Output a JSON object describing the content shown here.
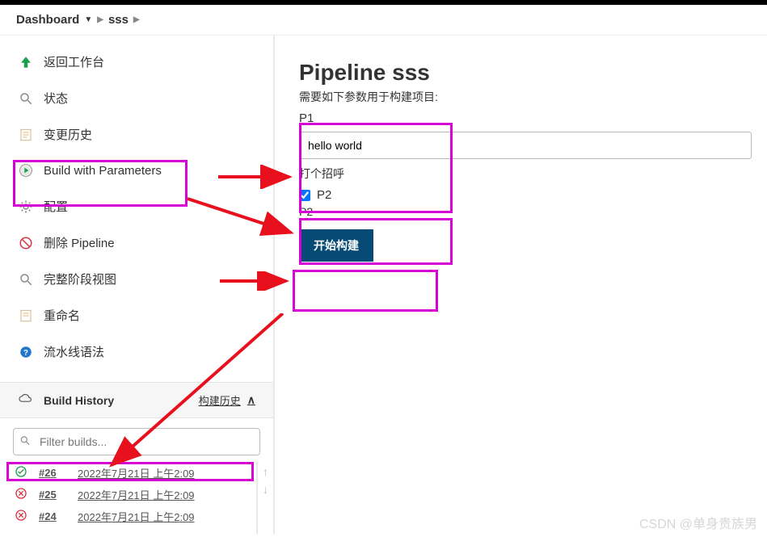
{
  "breadcrumbs": {
    "dashboard": "Dashboard",
    "project": "sss"
  },
  "sidebar": {
    "items": [
      {
        "label": "返回工作台",
        "icon": "arrow-up"
      },
      {
        "label": "状态",
        "icon": "search"
      },
      {
        "label": "变更历史",
        "icon": "notes"
      },
      {
        "label": "Build with Parameters",
        "icon": "play-gear"
      },
      {
        "label": "配置",
        "icon": "gear"
      },
      {
        "label": "删除 Pipeline",
        "icon": "delete"
      },
      {
        "label": "完整阶段视图",
        "icon": "search"
      },
      {
        "label": "重命名",
        "icon": "notes"
      },
      {
        "label": "流水线语法",
        "icon": "help"
      }
    ]
  },
  "buildHistory": {
    "title": "Build History",
    "subtitle": "构建历史",
    "filterPlaceholder": "Filter builds...",
    "rows": [
      {
        "num": "#26",
        "time": "2022年7月21日 上午2:09",
        "status": "ok"
      },
      {
        "num": "#25",
        "time": "2022年7月21日 上午2:09",
        "status": "fail"
      },
      {
        "num": "#24",
        "time": "2022年7月21日 上午2:09",
        "status": "fail"
      }
    ]
  },
  "page": {
    "title": "Pipeline sss",
    "subtitle": "需要如下参数用于构建项目:",
    "p1": {
      "label": "P1",
      "value": "hello world",
      "desc": "打个招呼"
    },
    "p2": {
      "label": "P2",
      "desc": "P2",
      "checked": true
    },
    "buildBtn": "开始构建"
  },
  "watermark": "CSDN @单身贵族男"
}
